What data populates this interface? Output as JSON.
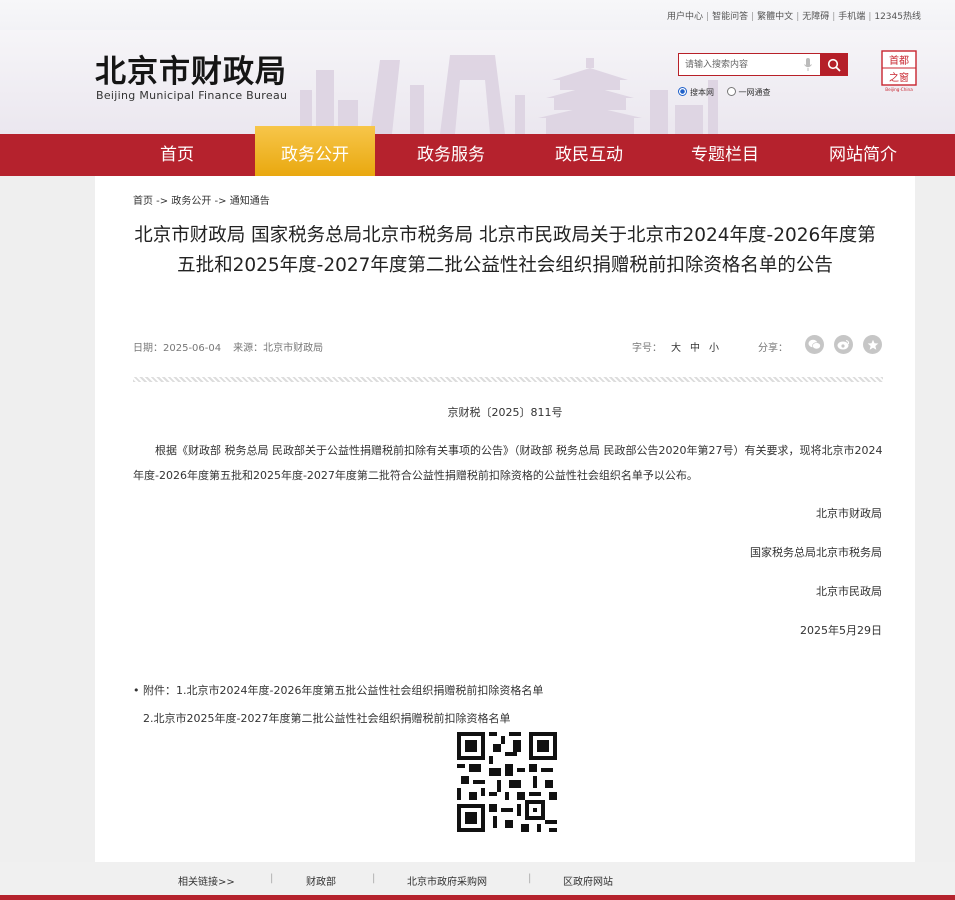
{
  "topbar": {
    "links": [
      "用户中心",
      "智能问答",
      "繁體中文",
      "无障碍",
      "手机端",
      "12345热线"
    ]
  },
  "header": {
    "logo_cn": "北京市财政局",
    "logo_en": "Beijing Municipal Finance Bureau",
    "search_placeholder": "请输入搜索内容",
    "radio_site": "搜本网",
    "radio_all": "一网通查",
    "badge_line1": "首都",
    "badge_line2": "之窗",
    "badge_sub": "Beijing·China"
  },
  "nav": {
    "items": [
      "首页",
      "政务公开",
      "政务服务",
      "政民互动",
      "专题栏目",
      "网站简介"
    ],
    "active_index": 1
  },
  "breadcrumb": "首页 -> 政务公开 -> 通知通告",
  "article": {
    "title": "北京市财政局 国家税务总局北京市税务局 北京市民政局关于北京市2024年度-2026年度第五批和2025年度-2027年度第二批公益性社会组织捐赠税前扣除资格名单的公告",
    "date": "日期：2025-06-04",
    "source": "来源：北京市财政局",
    "fontsize_label": "字号：",
    "fontsize_large": "大",
    "fontsize_medium": "中",
    "fontsize_small": "小",
    "share_label": "分享：",
    "doc_no": "京财税〔2025〕811号",
    "body": "根据《财政部 税务总局 民政部关于公益性捐赠税前扣除有关事项的公告》（财政部 税务总局 民政部公告2020年第27号）有关要求，现将北京市2024年度-2026年度第五批和2025年度-2027年度第二批符合公益性捐赠税前扣除资格的公益性社会组织名单予以公布。",
    "signatures": [
      "北京市财政局",
      "国家税务总局北京市税务局",
      "北京市民政局"
    ],
    "sign_date": "2025年5月29日",
    "attachments": [
      "• 附件：1.北京市2024年度-2026年度第五批公益性社会组织捐赠税前扣除资格名单",
      "2.北京市2025年度-2027年度第二批公益性社会组织捐赠税前扣除资格名单"
    ]
  },
  "footer": {
    "links": [
      "相关链接>>",
      "财政部",
      "北京市政府采购网",
      "区政府网站"
    ]
  },
  "colors": {
    "brand_red": "#b5222d",
    "nav_active": "#eeb226"
  }
}
